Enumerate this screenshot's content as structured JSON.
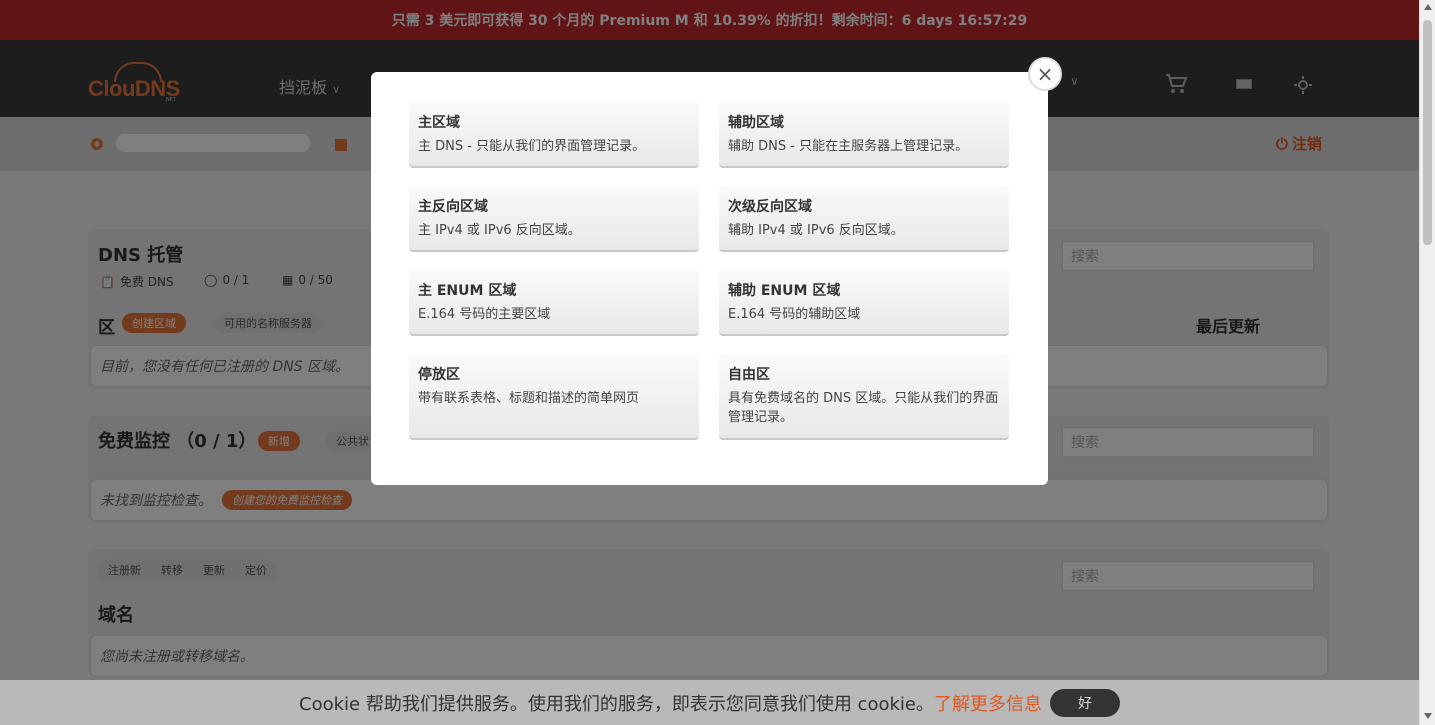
{
  "promo": "只需 3 美元即可获得 30 个月的 Premium M 和 10.39% 的折扣！剩余时间：6 days 16:57:29",
  "logo": {
    "text": "ClouDNS",
    "sub": ".NET"
  },
  "nav": {
    "dashboard": "挡泥板"
  },
  "logout": "注销",
  "dns": {
    "title": "DNS 托管",
    "stats": {
      "plan": "免费 DNS",
      "zones": "0 / 1",
      "records": "0 / 50"
    },
    "zone_label": "区",
    "create_zone": "创建区域",
    "nameservers": "可用的名称服务器",
    "last_updated": "最后更新",
    "empty": "目前，您没有任何已注册的 DNS 区域。",
    "search_placeholder": "搜索"
  },
  "monitor": {
    "title": "免费监控 （0 / 1）",
    "new": "新增",
    "public": "公共状",
    "empty": "未找到监控检查。",
    "create": "创建您的免费监控检查",
    "search_placeholder": "搜索"
  },
  "domains": {
    "tabs": [
      "注册新",
      "转移",
      "更新",
      "定价"
    ],
    "title": "域名",
    "empty": "您尚未注册或转移域名。",
    "search_placeholder": "搜索"
  },
  "modal": {
    "close": "×",
    "cards": [
      {
        "title": "主区域",
        "desc": "主 DNS - 只能从我们的界面管理记录。"
      },
      {
        "title": "辅助区域",
        "desc": "辅助 DNS - 只能在主服务器上管理记录。"
      },
      {
        "title": "主反向区域",
        "desc": "主 IPv4 或 IPv6 反向区域。"
      },
      {
        "title": "次级反向区域",
        "desc": "辅助 IPv4 或 IPv6 反向区域。"
      },
      {
        "title": "主 ENUM 区域",
        "desc": "E.164 号码的主要区域"
      },
      {
        "title": "辅助 ENUM 区域",
        "desc": "E.164 号码的辅助区域"
      },
      {
        "title": "停放区",
        "desc": "带有联系表格、标题和描述的简单网页"
      },
      {
        "title": "自由区",
        "desc": "具有免费域名的 DNS 区域。只能从我们的界面管理记录。"
      }
    ]
  },
  "cookie": {
    "text": "Cookie 帮助我们提供服务。使用我们的服务，即表示您同意我们使用 cookie。",
    "link": "了解更多信息",
    "ok": "好"
  },
  "colors": {
    "accent": "#e8743b",
    "promo": "#c0282c",
    "nav": "#3a3a3a"
  }
}
